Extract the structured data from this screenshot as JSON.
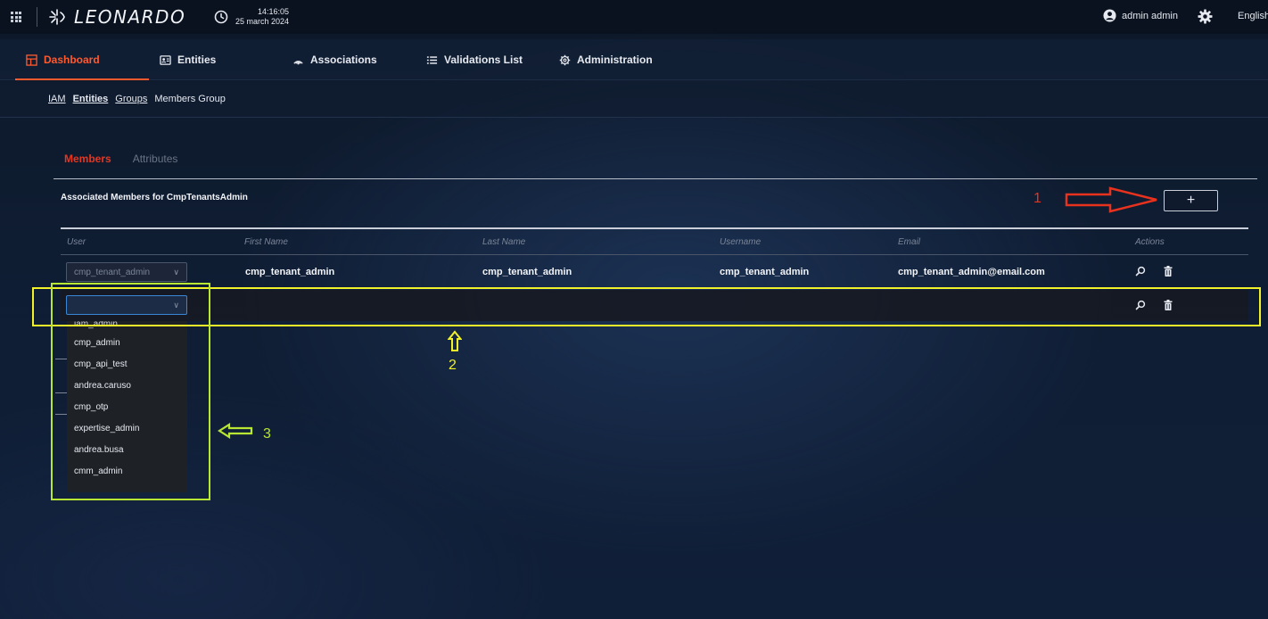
{
  "topbar": {
    "brand": "LEONARDO",
    "time": "14:16:05",
    "date": "25 march 2024",
    "user_name": "admin admin",
    "language": "English",
    "icons": [
      "grid-icon",
      "clock-icon",
      "user-icon",
      "gear-icon"
    ]
  },
  "nav": {
    "items": [
      {
        "label": "Dashboard",
        "icon": "dashboard-icon",
        "active": true
      },
      {
        "label": "Entities",
        "icon": "entities-icon",
        "active": false
      },
      {
        "label": "Associations",
        "icon": "associations-icon",
        "active": false
      },
      {
        "label": "Validations List",
        "icon": "list-icon",
        "active": false
      },
      {
        "label": "Administration",
        "icon": "settings-icon",
        "active": false
      }
    ]
  },
  "breadcrumb": {
    "items": [
      "IAM",
      "Entities",
      "Groups",
      "Members Group"
    ]
  },
  "tabs": {
    "members": "Members",
    "attributes": "Attributes"
  },
  "section": {
    "title": "Associated Members for CmpTenantsAdmin",
    "add_label": "+"
  },
  "table": {
    "headers": [
      "User",
      "First Name",
      "Last Name",
      "Username",
      "Email",
      "Actions"
    ],
    "rows": [
      {
        "user_select": "cmp_tenant_admin",
        "first_name": "cmp_tenant_admin",
        "last_name": "cmp_tenant_admin",
        "username": "cmp_tenant_admin",
        "email": "cmp_tenant_admin@email.com"
      },
      {
        "user_select": "",
        "first_name": "",
        "last_name": "",
        "username": "",
        "email": ""
      }
    ]
  },
  "dropdown": {
    "options": [
      "iam_admin",
      "cmp_admin",
      "cmp_api_test",
      "andrea.caruso",
      "cmp_otp",
      "expertise_admin",
      "andrea.busa",
      "cmm_admin"
    ]
  },
  "annotations": {
    "label_1": "1",
    "label_2": "2",
    "label_3": "3",
    "colors": {
      "red": "#e8321e",
      "yellow": "#f1f12a",
      "green": "#b9e632"
    }
  },
  "colors": {
    "accent": "#ff5a2e",
    "members_tab": "#e8351e",
    "focus_border": "#3a86d6"
  }
}
